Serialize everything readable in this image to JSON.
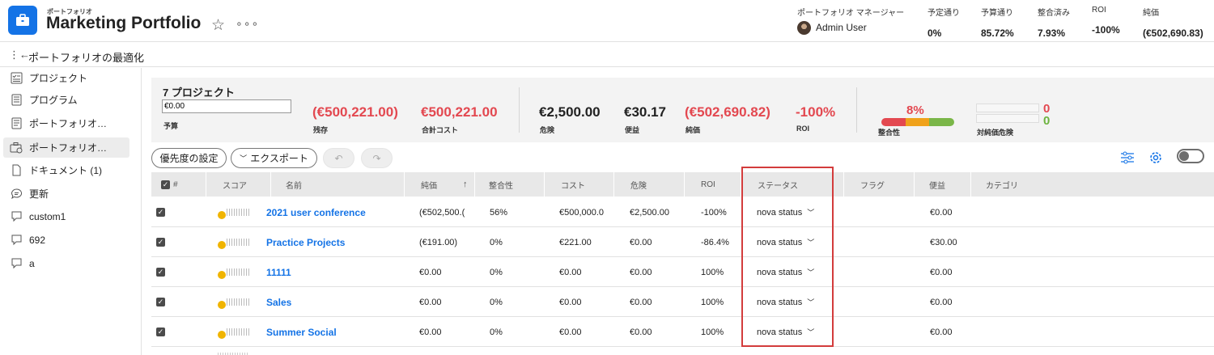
{
  "header": {
    "breadcrumb": "ポートフォリオ",
    "title": "Marketing Portfolio",
    "star_icon": "star-icon",
    "more_icon": "more-icon",
    "manager_label": "ポートフォリオ マネージャー",
    "manager_name": "Admin User",
    "metrics": [
      {
        "label": "予定通り",
        "value": "0%"
      },
      {
        "label": "予算通り",
        "value": "85.72%"
      },
      {
        "label": "整合済み",
        "value": "7.93%"
      },
      {
        "label": "ROI",
        "value": "-100%"
      },
      {
        "label": "純価",
        "value": "(€502,690.83)"
      }
    ]
  },
  "subbar": {
    "title": "ポートフォリオの最適化"
  },
  "sidebar": {
    "items": [
      {
        "label": "プロジェクト",
        "icon": "project-list-icon"
      },
      {
        "label": "プログラム",
        "icon": "program-icon"
      },
      {
        "label": "ポートフォリオ…",
        "icon": "portfolio-doc-icon"
      },
      {
        "label": "ポートフォリオ…",
        "icon": "portfolio-optimize-icon"
      },
      {
        "label": "ドキュメント (1)",
        "icon": "document-icon"
      },
      {
        "label": "更新",
        "icon": "comment-icon"
      },
      {
        "label": "custom1",
        "icon": "custom-form-icon"
      },
      {
        "label": "692",
        "icon": "custom-form-icon"
      },
      {
        "label": "a",
        "icon": "custom-form-icon"
      }
    ]
  },
  "summary": {
    "project_count": "7 プロジェクト",
    "budget_value": "€0.00",
    "budget_label": "予算",
    "items": [
      {
        "value": "(€500,221.00)",
        "label": "残存",
        "color": "#e34850"
      },
      {
        "value": "€500,221.00",
        "label": "合計コスト",
        "color": "#e34850"
      },
      {
        "value": "€2,500.00",
        "label": "危険",
        "color": "#222222"
      },
      {
        "value": "€30.17",
        "label": "便益",
        "color": "#222222"
      },
      {
        "value": "(€502,690.82)",
        "label": "純価",
        "color": "#e34850"
      },
      {
        "value": "-100%",
        "label": "ROI",
        "color": "#e34850"
      }
    ],
    "alignment_pct": "8%",
    "alignment_label": "整合性",
    "risk_values": [
      "0",
      "0"
    ],
    "risk_label": "対純価危険"
  },
  "toolbar": {
    "priority_label": "優先度の設定",
    "export_label": "エクスポート",
    "undo_icon": "undo-icon",
    "redo_icon": "redo-icon",
    "filter_icon": "sliders-icon",
    "settings_icon": "gear-icon"
  },
  "table": {
    "headers": [
      "#",
      "スコア",
      "名前",
      "純価",
      "整合性",
      "コスト",
      "危険",
      "ROI",
      "ステータス",
      "フラグ",
      "便益",
      "カテゴリ"
    ],
    "rows": [
      {
        "name": "2021 user conference",
        "net": "(€502,500.(",
        "align": "56%",
        "cost": "€500,000.0",
        "risk": "€2,500.00",
        "roi": "-100%",
        "status": "nova status",
        "benefit": "€0.00"
      },
      {
        "name": "Practice Projects",
        "net": "(€191.00)",
        "align": "0%",
        "cost": "€221.00",
        "risk": "€0.00",
        "roi": "-86.4%",
        "status": "nova status",
        "benefit": "€30.00"
      },
      {
        "name": "11111",
        "net": "€0.00",
        "align": "0%",
        "cost": "€0.00",
        "risk": "€0.00",
        "roi": "100%",
        "status": "nova status",
        "benefit": "€0.00"
      },
      {
        "name": "Sales",
        "net": "€0.00",
        "align": "0%",
        "cost": "€0.00",
        "risk": "€0.00",
        "roi": "100%",
        "status": "nova status",
        "benefit": "€0.00"
      },
      {
        "name": "Summer Social",
        "net": "€0.00",
        "align": "0%",
        "cost": "€0.00",
        "risk": "€0.00",
        "roi": "100%",
        "status": "nova status",
        "benefit": "€0.00"
      }
    ]
  },
  "colors": {
    "accent": "#1473e6",
    "negative": "#e34850",
    "highlight": "#d33c3c"
  }
}
